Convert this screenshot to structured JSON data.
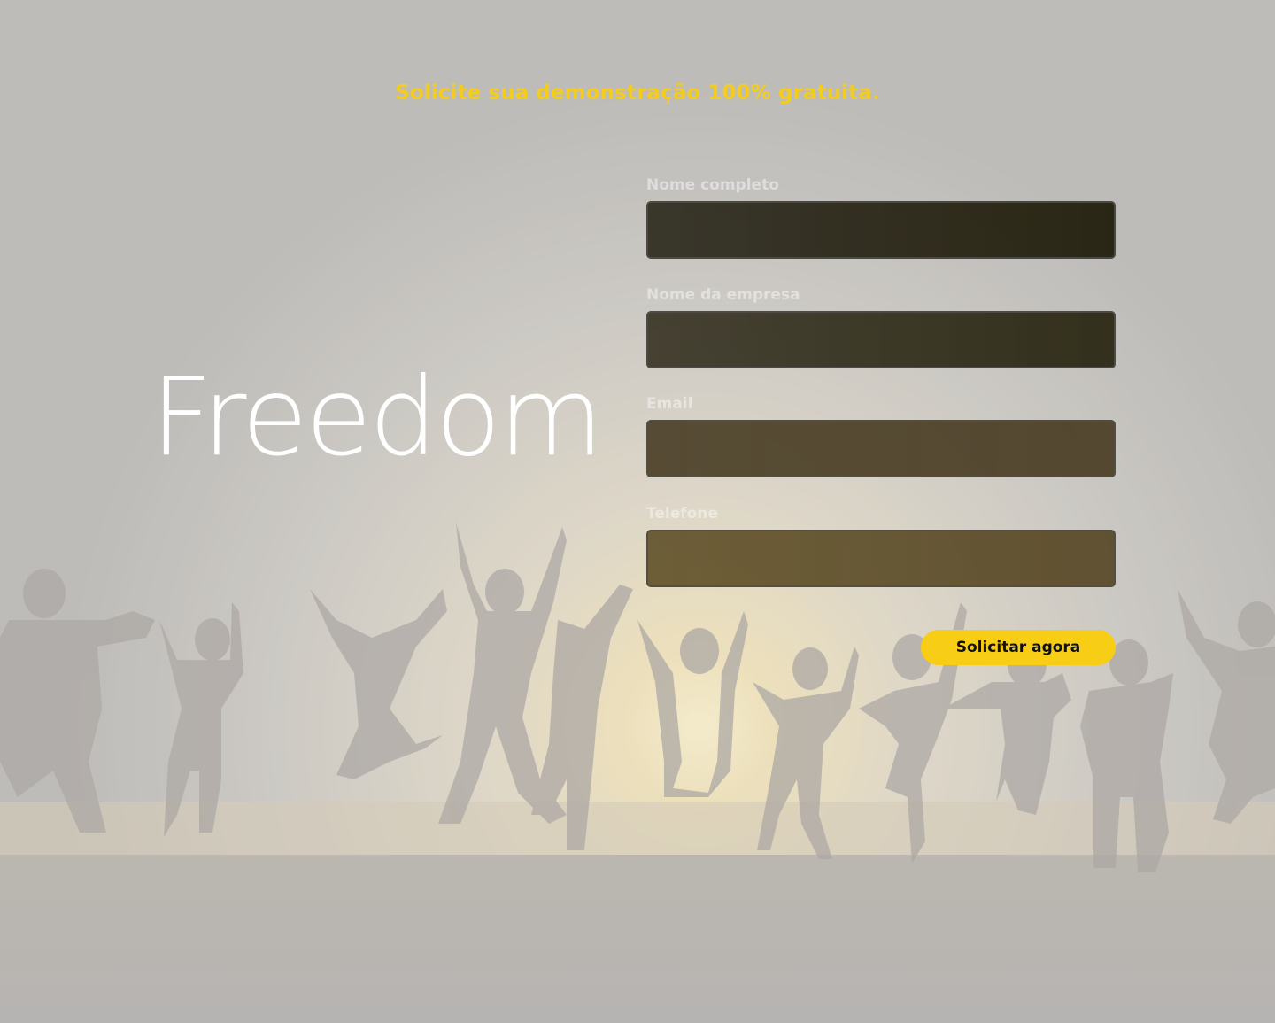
{
  "headline": "Solicite sua demonstração 100% gratuita.",
  "brand": {
    "name": "Freedom"
  },
  "form": {
    "fields": [
      {
        "label": "Nome completo",
        "value": "",
        "placeholder": ""
      },
      {
        "label": "Nome da empresa",
        "value": "",
        "placeholder": ""
      },
      {
        "label": "Email",
        "value": "",
        "placeholder": ""
      },
      {
        "label": "Telefone",
        "value": "",
        "placeholder": ""
      }
    ],
    "submit_label": "Solicitar agora"
  },
  "background": {
    "image": "sunset-beach-jumping-people",
    "overlay_color": "#c0bfbc"
  },
  "colors": {
    "accent": "#f7cd16",
    "headline": "#f4cc1e",
    "logo": "#ffffff"
  }
}
